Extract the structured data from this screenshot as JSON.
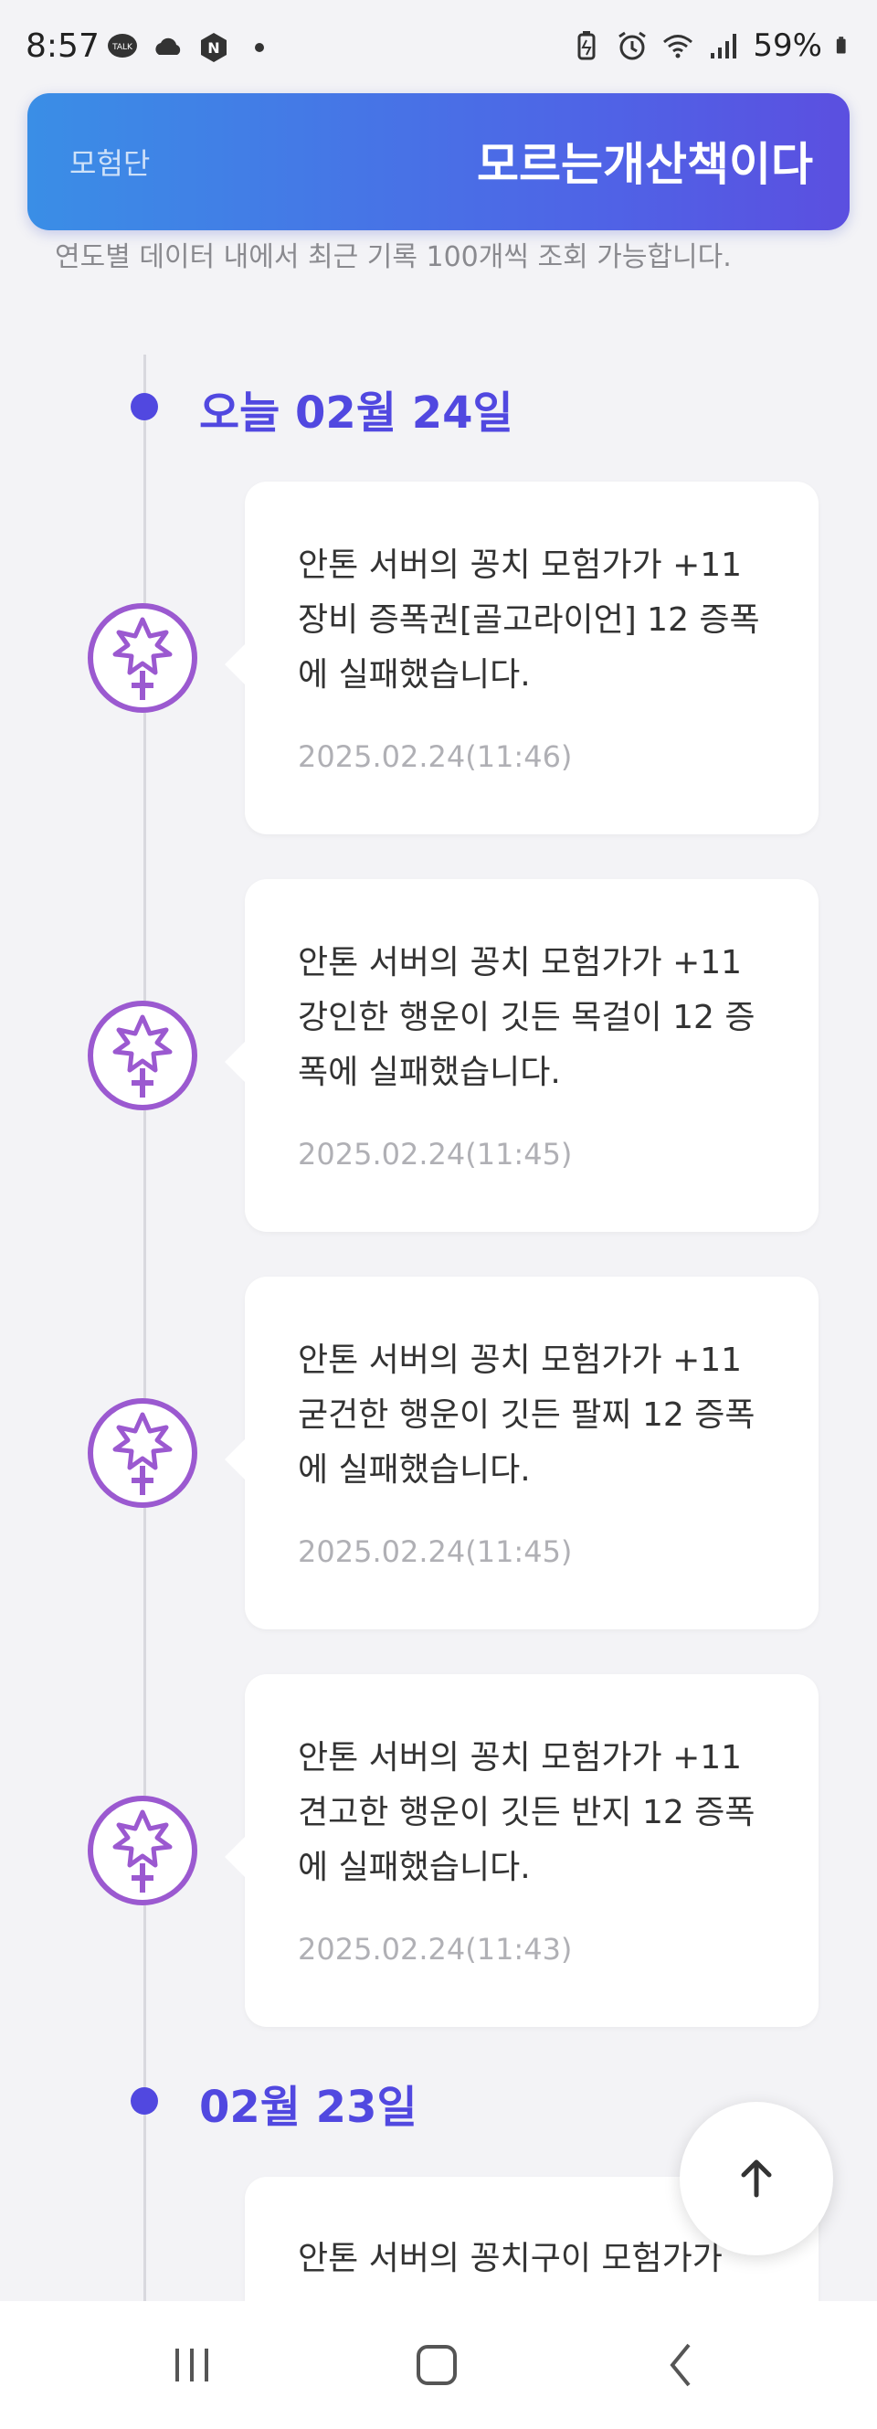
{
  "status_bar": {
    "time": "8:57",
    "battery": "59%",
    "icons_left": [
      "talk-icon",
      "cloud-icon",
      "n-icon",
      "dot-icon"
    ],
    "icons_right": [
      "battery-saver-icon",
      "alarm-icon",
      "wifi-icon",
      "signal-icon",
      "battery-icon"
    ]
  },
  "banner": {
    "left_text": "모험단",
    "right_text": "모르는개산책이다",
    "gradient": [
      "#3a8ee6",
      "#5b4fe0"
    ]
  },
  "note": "연도별 데이터 내에서 최근 기록 100개씩 조회 가능합니다.",
  "accent": "#5148e0",
  "sections": [
    {
      "date_label": "오늘 02월 24일",
      "entries": [
        {
          "message": "안톤 서버의 꽁치 모험가가 +11 장비 증폭권[골고라이언] 12 증폭에 실패했습니다.",
          "timestamp": "2025.02.24(11:46)"
        },
        {
          "message": "안톤 서버의 꽁치 모험가가 +11 강인한 행운이 깃든 목걸이 12 증폭에 실패했습니다.",
          "timestamp": "2025.02.24(11:45)"
        },
        {
          "message": "안톤 서버의 꽁치 모험가가 +11 굳건한 행운이 깃든 팔찌 12 증폭에 실패했습니다.",
          "timestamp": "2025.02.24(11:45)"
        },
        {
          "message": "안톤 서버의 꽁치 모험가가 +11 견고한 행운이 깃든 반지 12 증폭에 실패했습니다.",
          "timestamp": "2025.02.24(11:43)"
        }
      ]
    },
    {
      "date_label": "02월 23일",
      "entries": [
        {
          "message": "안톤 서버의 꽁치구이 모험가가",
          "timestamp": ""
        }
      ]
    }
  ],
  "fab_icon": "arrow-up-icon",
  "nav": [
    "recent-apps-icon",
    "home-icon",
    "back-icon"
  ]
}
